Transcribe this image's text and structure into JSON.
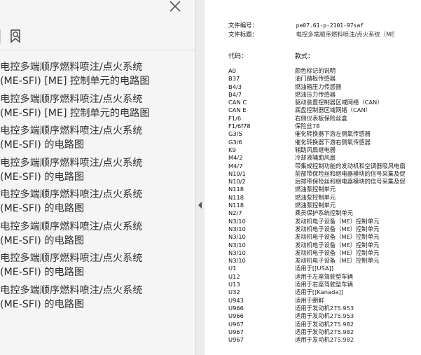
{
  "bookmarks": [
    {
      "line1": "电控多端顺序燃料喷注/点火系统",
      "line2": "(ME-SFI) [ME] 控制单元的电路图"
    },
    {
      "line1": "电控多端顺序燃料喷注/点火系统",
      "line2": "(ME-SFI) [ME] 控制单元的电路图"
    },
    {
      "line1": "电控多端顺序燃料喷注/点火系统",
      "line2": "(ME-SFI) 的电路图"
    },
    {
      "line1": "电控多端顺序燃料喷注/点火系统",
      "line2": "(ME-SFI) 的电路图"
    },
    {
      "line1": "电控多端顺序燃料喷注/点火系统",
      "line2": "(ME-SFI) 的电路图"
    },
    {
      "line1": "电控多端顺序燃料喷注/点火系统",
      "line2": "(ME-SFI) 的电路图"
    },
    {
      "line1": "电控多端顺序燃料喷注/点火系统",
      "line2": "(ME-SFI) 的电路图"
    },
    {
      "line1": "电控多端顺序燃料喷注/点火系统",
      "line2": "(ME-SFI) 的电路图"
    }
  ],
  "icons": {
    "close": "close-icon",
    "bookmark": "bookmark-search-icon",
    "collapse": "collapse-left-icon"
  },
  "doc": {
    "file_no_label": "文件编号：",
    "file_no_value": "pe07.61-p-2101-97saf",
    "file_title_label": "文件标题：",
    "file_title_value": "电控多端顺序燃料喷注/点火系统（ME",
    "col_code": "代码：",
    "col_desc": "款式：",
    "rows": [
      {
        "code": "A0",
        "desc": "颜色标记的说明"
      },
      {
        "code": "B37",
        "desc": "油门踏板传感器"
      },
      {
        "code": "B4/3",
        "desc": "燃油箱压力传感器"
      },
      {
        "code": "B4/7",
        "desc": "燃油压力传感器"
      },
      {
        "code": "CAN C",
        "desc": "驱动装置控制器区域网络（CAN）"
      },
      {
        "code": "CAN E",
        "desc": "底盘控制器区域网络（CAN）"
      },
      {
        "code": "F1/6",
        "desc": "右侧仪表板保险丝盒"
      },
      {
        "code": "F1/6f78",
        "desc": "保险丝78"
      },
      {
        "code": "G3/5",
        "desc": "催化转换器下游左侧氧传感器"
      },
      {
        "code": "G3/6",
        "desc": "催化转换器下游右侧氧传感器"
      },
      {
        "code": "K9",
        "desc": "辅助风扇继电器"
      },
      {
        "code": "M4/2",
        "desc": "冷却液辅助风扇"
      },
      {
        "code": "M4/7",
        "desc": "带集成控制功能的发动机和空调器吸风电扇"
      },
      {
        "code": "N10/1",
        "desc": "前部带保险丝和继电器模块的信号采集及促"
      },
      {
        "code": "N10/2",
        "desc": "后排带保险丝和继电器模块的信号采集及促"
      },
      {
        "code": "N118",
        "desc": "燃油泵控制单元"
      },
      {
        "code": "N118",
        "desc": "燃油泵控制单元"
      },
      {
        "code": "N118",
        "desc": "燃油泵控制单元"
      },
      {
        "code": "N2/7",
        "desc": "乘员保护系统控制单元"
      },
      {
        "code": "N3/10",
        "desc": "发动机电子设备（ME）控制单元"
      },
      {
        "code": "N3/10",
        "desc": "发动机电子设备（ME）控制单元"
      },
      {
        "code": "N3/10",
        "desc": "发动机电子设备（ME）控制单元"
      },
      {
        "code": "N3/10",
        "desc": "发动机电子设备（ME）控制单元"
      },
      {
        "code": "N3/10",
        "desc": "发动机电子设备（ME）控制单元"
      },
      {
        "code": "N3/10",
        "desc": "发动机电子设备（ME）控制单元"
      },
      {
        "code": "U1",
        "desc": "适用于[[USA]]"
      },
      {
        "code": "U12",
        "desc": "适用于左座驾驶型车辆"
      },
      {
        "code": "U13",
        "desc": "适用于右座驾驶型车辆"
      },
      {
        "code": "U32",
        "desc": "适用于[[Kanada]]"
      },
      {
        "code": "U943",
        "desc": "适用于朝鲜"
      },
      {
        "code": "U966",
        "desc": "适用于发动机275.953"
      },
      {
        "code": "U966",
        "desc": "适用于发动机275.953"
      },
      {
        "code": "U967",
        "desc": "适用于发动机275.982"
      },
      {
        "code": "U967",
        "desc": "适用于发动机275.982"
      },
      {
        "code": "U967",
        "desc": "适用于发动机275.982"
      }
    ]
  }
}
